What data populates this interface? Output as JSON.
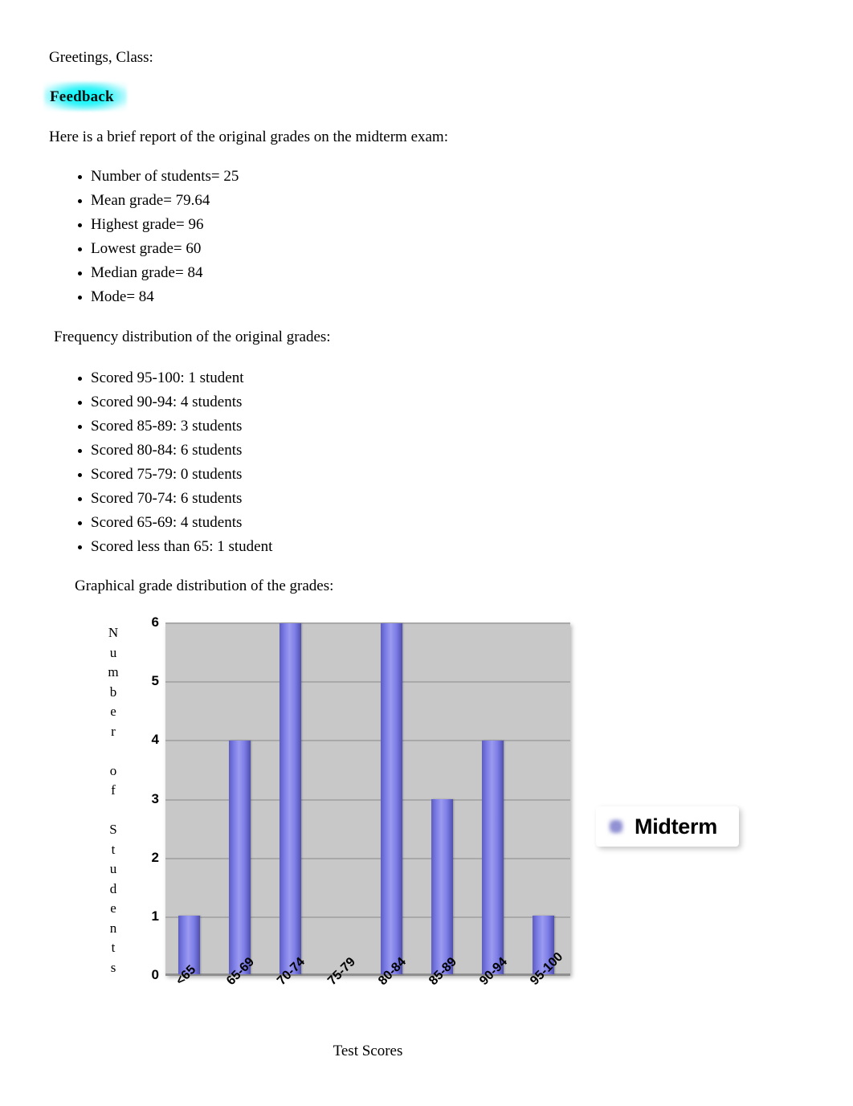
{
  "document": {
    "greeting": "Greetings, Class:",
    "feedback_heading": "Feedback",
    "feedback_highlight_color": "#00FFFF",
    "intro": "Here is a brief report of the original grades on the midterm exam:",
    "stats_heading": "",
    "stats": [
      "Number of students= 25",
      "Mean grade= 79.64",
      "Highest grade= 96",
      "Lowest grade= 60",
      "Median grade= 84",
      "Mode= 84"
    ],
    "frequency_heading": "Frequency distribution of the original grades:",
    "frequency": [
      "Scored 95-100: 1 student",
      "Scored 90-94: 4 students",
      "Scored 85-89: 3 students",
      "Scored 80-84: 6 students",
      "Scored 75-79: 0 students",
      "Scored 70-74: 6 students",
      "Scored 65-69: 4 students",
      "Scored less than 65: 1 student"
    ],
    "graph_heading": "Graphical grade distribution of the grades:"
  },
  "chart_data": {
    "type": "bar",
    "title": "",
    "categories": [
      "<65",
      "65-69",
      "70-74",
      "75-79",
      "80-84",
      "85-89",
      "90-94",
      "95-100"
    ],
    "values": [
      1,
      4,
      6,
      0,
      6,
      3,
      4,
      1
    ],
    "series": [
      {
        "name": "Midterm",
        "values": [
          1,
          4,
          6,
          0,
          6,
          3,
          4,
          1
        ],
        "color": "#8080E0"
      }
    ],
    "xlabel": "Test Scores",
    "ylabel": "Number of Students",
    "ylim": [
      0,
      6
    ],
    "yticks": [
      "0",
      "1",
      "2",
      "3",
      "4",
      "5",
      "6"
    ],
    "grid": true,
    "legend_position": "right",
    "legend_entries": [
      "Midterm"
    ],
    "plot_background": "#C8C8C8",
    "gridline_color": "#A9A9A9"
  }
}
